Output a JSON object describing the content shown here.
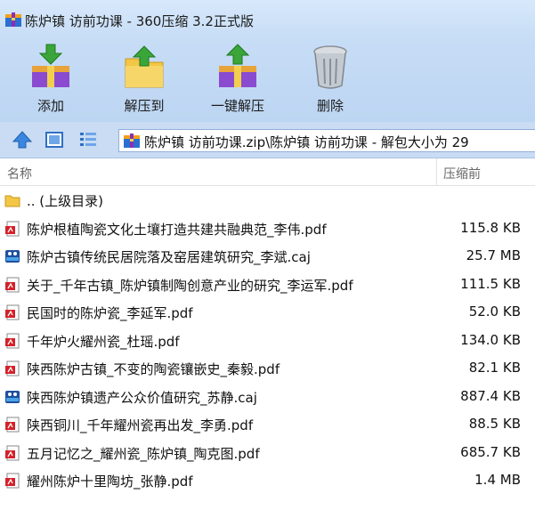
{
  "window": {
    "title": "陈炉镇 访前功课 - 360压缩 3.2正式版"
  },
  "toolbar": {
    "buttons": [
      {
        "label": "添加",
        "icon": "add-box-icon"
      },
      {
        "label": "解压到",
        "icon": "extract-folder-icon"
      },
      {
        "label": "一键解压",
        "icon": "one-click-extract-icon"
      },
      {
        "label": "删除",
        "icon": "trash-bin-icon"
      }
    ]
  },
  "nav": {
    "path": "陈炉镇 访前功课.zip\\陈炉镇 访前功课 - 解包大小为 29"
  },
  "columns": {
    "name": "名称",
    "compressed": "压缩前"
  },
  "files": [
    {
      "name": ".. (上级目录)",
      "size": "",
      "type": "folder"
    },
    {
      "name": "陈炉根植陶瓷文化土壤打造共建共融典范_李伟.pdf",
      "size": "115.8 KB",
      "type": "pdf"
    },
    {
      "name": "陈炉古镇传统民居院落及窑居建筑研究_李斌.caj",
      "size": "25.7 MB",
      "type": "caj"
    },
    {
      "name": "关于_千年古镇_陈炉镇制陶创意产业的研究_李运军.pdf",
      "size": "111.5 KB",
      "type": "pdf"
    },
    {
      "name": "民国时的陈炉瓷_李延军.pdf",
      "size": "52.0 KB",
      "type": "pdf"
    },
    {
      "name": "千年炉火耀州瓷_杜瑶.pdf",
      "size": "134.0 KB",
      "type": "pdf"
    },
    {
      "name": "陕西陈炉古镇_不变的陶瓷镶嵌史_秦毅.pdf",
      "size": "82.1 KB",
      "type": "pdf"
    },
    {
      "name": "陕西陈炉镇遗产公众价值研究_苏静.caj",
      "size": "887.4 KB",
      "type": "caj"
    },
    {
      "name": "陕西铜川_千年耀州瓷再出发_李勇.pdf",
      "size": "88.5 KB",
      "type": "pdf"
    },
    {
      "name": "五月记忆之_耀州瓷_陈炉镇_陶克图.pdf",
      "size": "685.7 KB",
      "type": "pdf"
    },
    {
      "name": "耀州陈炉十里陶坊_张静.pdf",
      "size": "1.4 MB",
      "type": "pdf"
    }
  ]
}
